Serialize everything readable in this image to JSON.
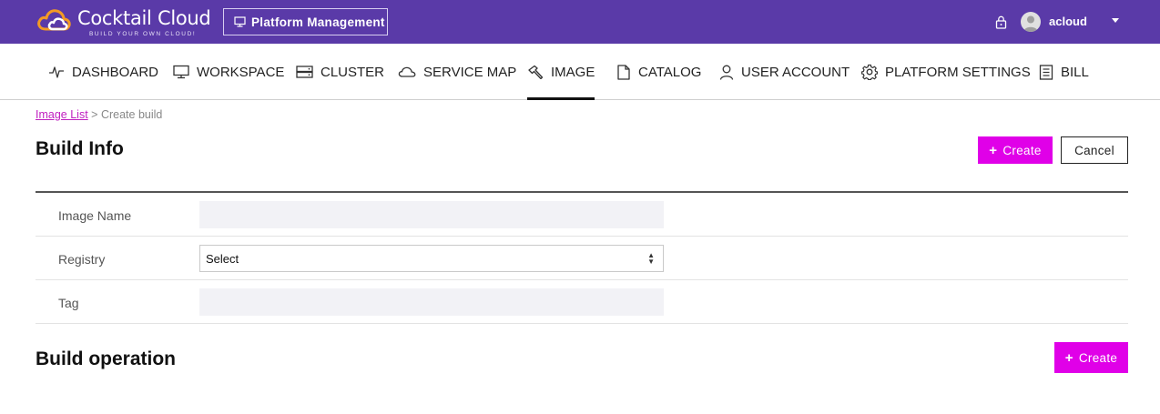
{
  "app": {
    "logo_name": "Cocktail Cloud",
    "logo_tagline": "BUILD YOUR OWN CLOUD!",
    "platform_button": "Platform Management",
    "username": "acloud"
  },
  "nav": {
    "items": [
      {
        "label": "DASHBOARD",
        "icon": "activity-icon"
      },
      {
        "label": "WORKSPACE",
        "icon": "monitor-icon"
      },
      {
        "label": "CLUSTER",
        "icon": "server-icon"
      },
      {
        "label": "SERVICE MAP",
        "icon": "cloud-icon"
      },
      {
        "label": "IMAGE",
        "icon": "hammer-icon",
        "active": true
      },
      {
        "label": "CATALOG",
        "icon": "document-icon"
      },
      {
        "label": "USER ACCOUNT",
        "icon": "user-icon"
      },
      {
        "label": "PLATFORM SETTINGS",
        "icon": "gear-icon"
      },
      {
        "label": "BILL",
        "icon": "bill-icon"
      }
    ]
  },
  "breadcrumb": {
    "link": "Image List",
    "separator": ">",
    "current": "Create build"
  },
  "build_info": {
    "title": "Build Info",
    "create_label": "Create",
    "cancel_label": "Cancel",
    "fields": {
      "image_name_label": "Image Name",
      "image_name_value": "",
      "registry_label": "Registry",
      "registry_selected": "Select",
      "tag_label": "Tag",
      "tag_value": ""
    }
  },
  "build_operation": {
    "title": "Build operation",
    "create_label": "Create"
  },
  "colors": {
    "topbar": "#5a3aa8",
    "accent": "#e000e8",
    "link": "#c020c0"
  }
}
